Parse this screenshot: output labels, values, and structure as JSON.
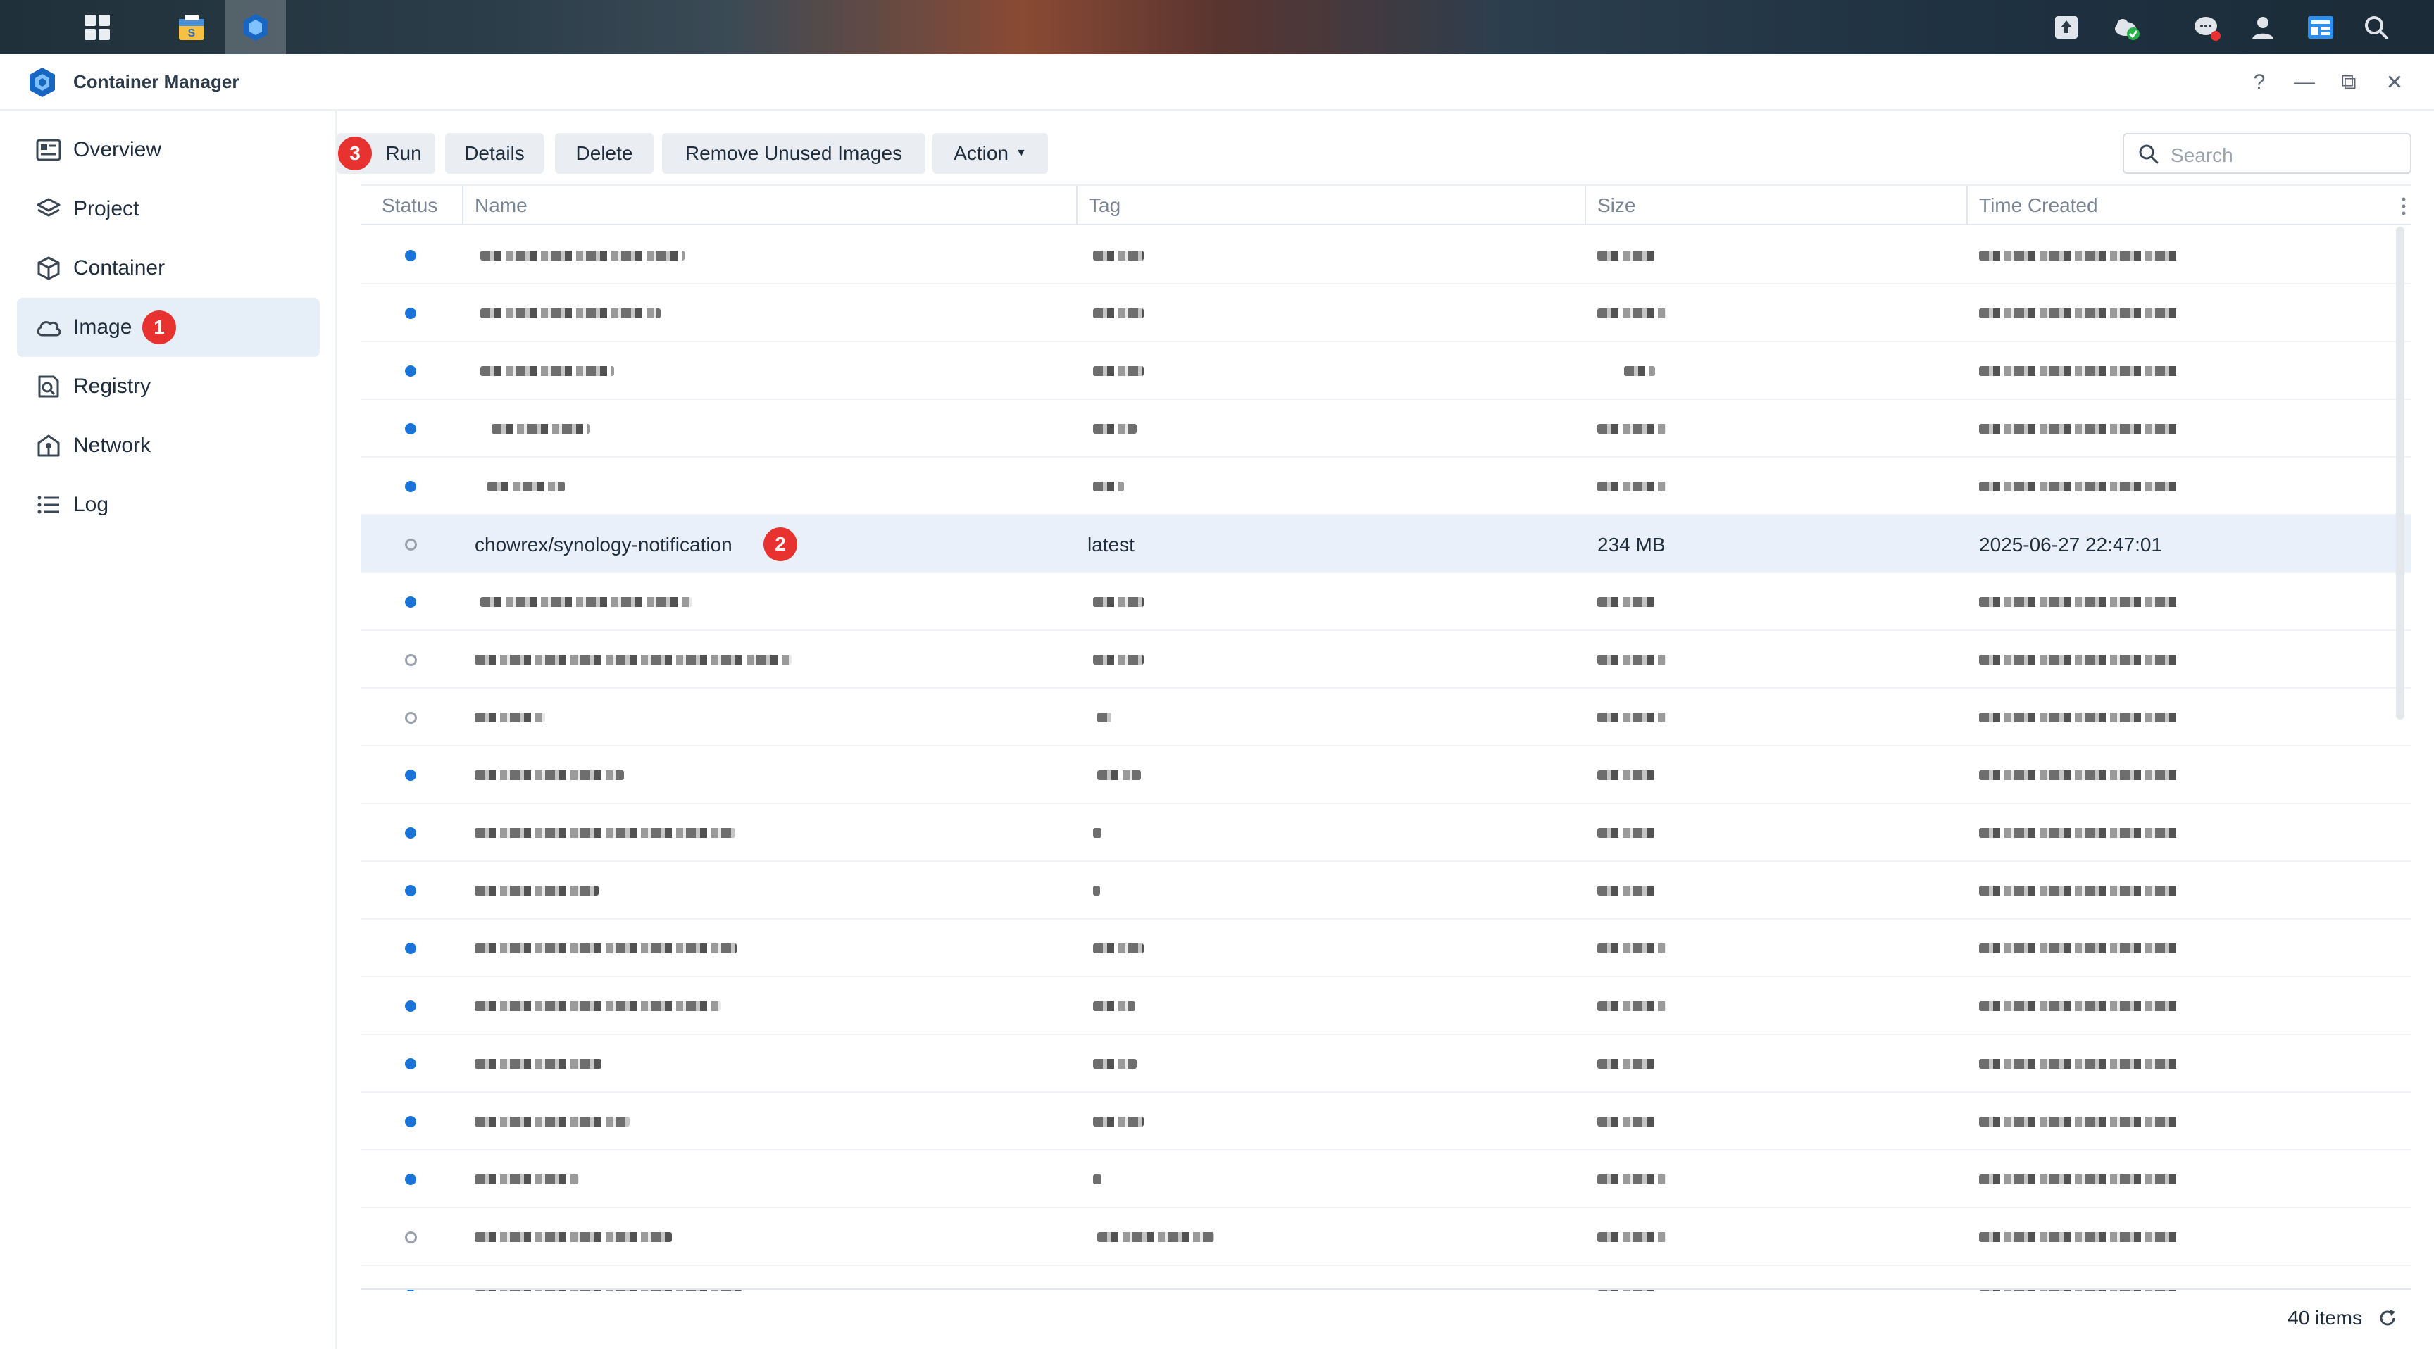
{
  "window": {
    "title": "Container Manager",
    "controls": [
      "?",
      "—",
      "⧉",
      "✕"
    ]
  },
  "sidebar": {
    "items": [
      {
        "label": "Overview",
        "icon": "overview-icon"
      },
      {
        "label": "Project",
        "icon": "layers-icon"
      },
      {
        "label": "Container",
        "icon": "cube-icon"
      },
      {
        "label": "Image",
        "icon": "cloud-icon",
        "badge": "1"
      },
      {
        "label": "Registry",
        "icon": "registry-icon"
      },
      {
        "label": "Network",
        "icon": "network-icon"
      },
      {
        "label": "Log",
        "icon": "list-icon"
      }
    ]
  },
  "toolbar": {
    "run_badge": "3",
    "run": "Run",
    "details": "Details",
    "delete": "Delete",
    "remove_unused": "Remove Unused Images",
    "action": "Action"
  },
  "search": {
    "placeholder": "Search"
  },
  "table": {
    "columns": [
      "Status",
      "Name",
      "Tag",
      "Size",
      "Time Created"
    ],
    "selected_row": {
      "name": "chowrex/synology-notification",
      "badge": "2",
      "tag": "latest",
      "size": "234 MB",
      "time": "2025-06-27 22:47:01"
    }
  },
  "footer": {
    "count": "40 items"
  },
  "colors": {
    "accent": "#1a73d8",
    "badge": "#e8322f",
    "selected": "#e9f0f9"
  }
}
